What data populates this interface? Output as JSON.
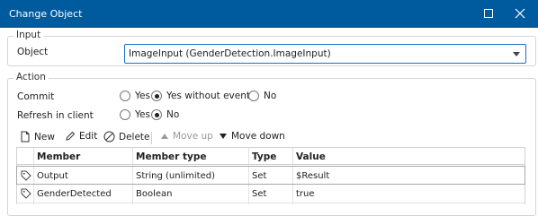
{
  "window": {
    "title": "Change Object"
  },
  "input_group": {
    "legend": "Input",
    "object_label": "Object",
    "object_value": "ImageInput (GenderDetection.ImageInput)"
  },
  "action_group": {
    "legend": "Action",
    "commit": {
      "label": "Commit",
      "options": [
        "Yes",
        "Yes without events",
        "No"
      ],
      "selected": "Yes without events"
    },
    "refresh": {
      "label": "Refresh in client",
      "options": [
        "Yes",
        "No"
      ],
      "selected": "No"
    }
  },
  "toolbar": {
    "new_label": "New",
    "edit_label": "Edit",
    "delete_label": "Delete",
    "move_up_label": "Move up",
    "move_down_label": "Move down"
  },
  "table": {
    "columns": [
      "Member",
      "Member type",
      "Type",
      "Value"
    ],
    "rows": [
      {
        "member": "Output",
        "member_type": "String (unlimited)",
        "type": "Set",
        "value": "$Result"
      },
      {
        "member": "GenderDetected",
        "member_type": "Boolean",
        "type": "Set",
        "value": "true"
      }
    ]
  }
}
